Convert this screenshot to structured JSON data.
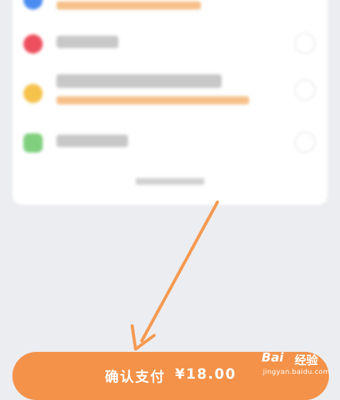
{
  "payment_methods": [
    {
      "name": "",
      "note": "",
      "icon": "wallet-icon",
      "color": "#4a8cf0"
    },
    {
      "name": "",
      "note": "",
      "icon": "card-icon",
      "color": "#ee4f5e"
    },
    {
      "name": "",
      "note": "",
      "icon": "coin-icon",
      "color": "#f5c24c"
    },
    {
      "name": "",
      "note": "",
      "icon": "wechat-icon",
      "color": "#7fcf7f"
    }
  ],
  "more_methods": "",
  "confirm_button": {
    "label": "确认支付",
    "currency": "¥",
    "amount": "18.00"
  },
  "watermark": {
    "logo": "Bai",
    "cn": "经验",
    "url": "jingyan.baidu.com"
  },
  "colors": {
    "accent": "#f4924a",
    "background": "#ecedf0",
    "card": "#ffffff"
  }
}
